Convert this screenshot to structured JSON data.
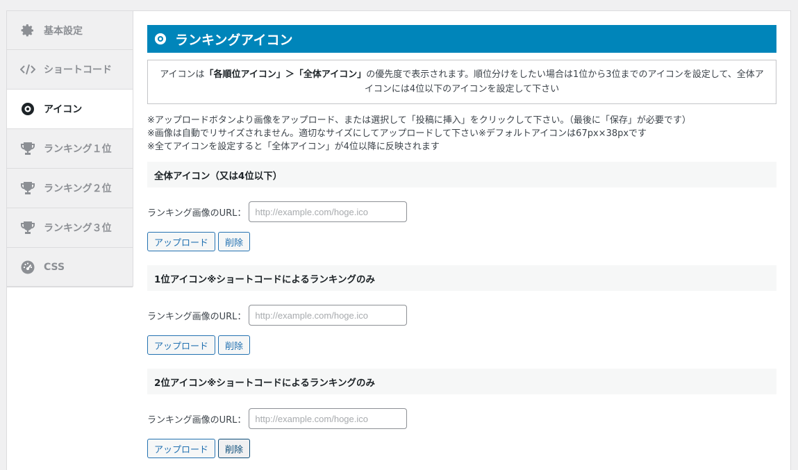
{
  "sidebar": {
    "items": [
      {
        "label": "基本設定",
        "icon": "gear-icon"
      },
      {
        "label": "ショートコード",
        "icon": "code-icon"
      },
      {
        "label": "アイコン",
        "icon": "eye-icon"
      },
      {
        "label": "ランキング１位",
        "icon": "trophy-icon"
      },
      {
        "label": "ランキング２位",
        "icon": "trophy-icon"
      },
      {
        "label": "ランキング３位",
        "icon": "trophy-icon"
      },
      {
        "label": "CSS",
        "icon": "dashboard-icon"
      }
    ],
    "active_index": 2
  },
  "header": {
    "title": "ランキングアイコン",
    "accent": "#0085ba"
  },
  "notice": {
    "prefix": "アイコンは",
    "bold1": "「各順位アイコン」＞「全体アイコン」",
    "suffix": "の優先度で表示されます。順位分けをしたい場合は1位から3位までのアイコンを設定して、全体アイコンには4位以下のアイコンを設定して下さい"
  },
  "notes": [
    "※アップロードボタンより画像をアップロード、または選択して「投稿に挿入」をクリックして下さい。（最後に「保存」が必要です）",
    "※画像は自動でリサイズされません。適切なサイズにしてアップロードして下さい※デフォルトアイコンは67px×38pxです",
    "※全てアイコンを設定すると「全体アイコン」が4位以降に反映されます"
  ],
  "sections": [
    {
      "title": "全体アイコン（又は4位以下）",
      "field_label": "ランキング画像のURL：",
      "placeholder": "http://example.com/hoge.ico",
      "value": "",
      "upload_label": "アップロード",
      "delete_label": "削除"
    },
    {
      "title": "1位アイコン※ショートコードによるランキングのみ",
      "field_label": "ランキング画像のURL：",
      "placeholder": "http://example.com/hoge.ico",
      "value": "",
      "upload_label": "アップロード",
      "delete_label": "削除"
    },
    {
      "title": "2位アイコン※ショートコードによるランキングのみ",
      "field_label": "ランキング画像のURL：",
      "placeholder": "http://example.com/hoge.ico",
      "value": "",
      "upload_label": "アップロード",
      "delete_label": "削除"
    }
  ]
}
